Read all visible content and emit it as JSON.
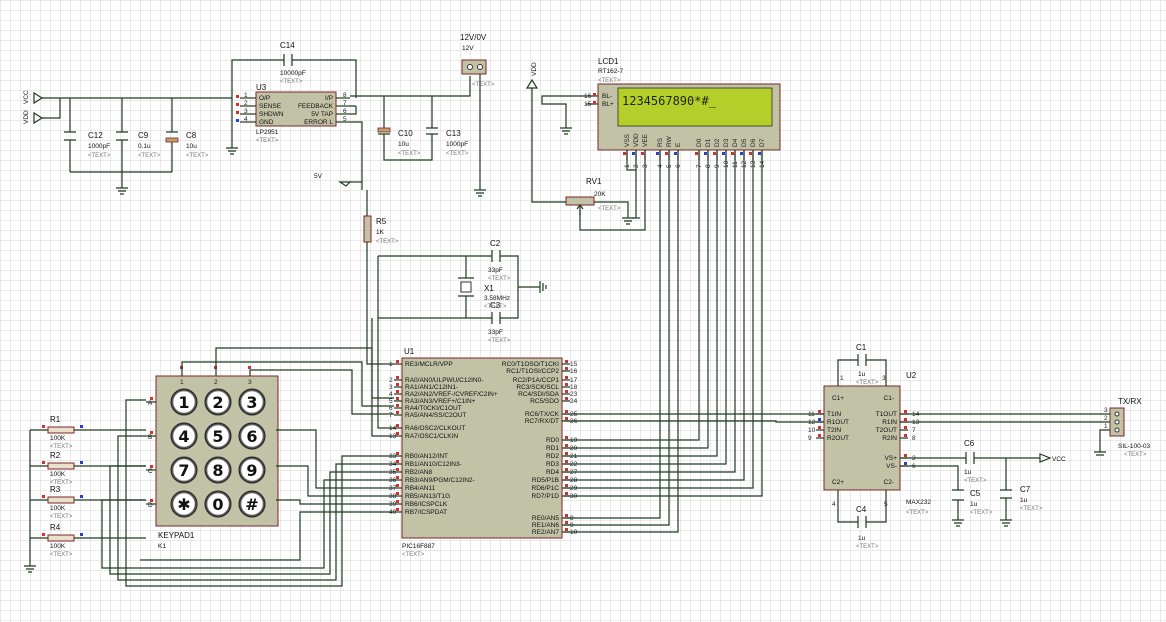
{
  "power": {
    "vcc_left_1": "VCC",
    "vcc_left_2": "VDD",
    "vdd_top": "VDD",
    "five_v": "5V",
    "vcc_right": "VCC",
    "supply_name": "12V/0V",
    "supply_value": "12V"
  },
  "placeholder": "<TEXT>",
  "regulator": {
    "ref": "U3",
    "part": "LP2951",
    "pins_left": [
      "O/P",
      "SENSE",
      "SHDWN",
      "GND"
    ],
    "pins_right": [
      "I/P",
      "FEEDBACK",
      "5V TAP",
      "ERROR L"
    ],
    "pin_numbers_left": [
      "1",
      "2",
      "3",
      "4"
    ],
    "pin_numbers_right": [
      "8",
      "7",
      "6",
      "5"
    ]
  },
  "capacitors": {
    "c14": {
      "ref": "C14",
      "value": "10000pF"
    },
    "c12": {
      "ref": "C12",
      "value": "1000pF"
    },
    "c9": {
      "ref": "C9",
      "value": "0.1u"
    },
    "c8": {
      "ref": "C8",
      "value": "10u"
    },
    "c10": {
      "ref": "C10",
      "value": "10u"
    },
    "c13": {
      "ref": "C13",
      "value": "1000pF"
    },
    "c2": {
      "ref": "C2",
      "value": "33pF"
    },
    "c3": {
      "ref": "C3",
      "value": "33pF"
    },
    "c1": {
      "ref": "C1",
      "value": "1u"
    },
    "c4": {
      "ref": "C4",
      "value": "1u"
    },
    "c5": {
      "ref": "C5",
      "value": "1u"
    },
    "c6": {
      "ref": "C6",
      "value": "1u"
    },
    "c7": {
      "ref": "C7",
      "value": "1u"
    }
  },
  "crystal": {
    "ref": "X1",
    "value": "3.58MHz"
  },
  "resistors": {
    "r5": {
      "ref": "R5",
      "value": "1K"
    },
    "r1": {
      "ref": "R1",
      "value": "100K"
    },
    "r2": {
      "ref": "R2",
      "value": "100K"
    },
    "r3": {
      "ref": "R3",
      "value": "100K"
    },
    "r4": {
      "ref": "R4",
      "value": "100K"
    }
  },
  "pot": {
    "ref": "RV1",
    "value": "20K"
  },
  "lcd": {
    "ref": "LCD1",
    "part": "RT162-7",
    "display_text": "1234567890*#_",
    "pins": [
      "VSS",
      "VDD",
      "VEE",
      "RS",
      "RW",
      "E",
      "D0",
      "D1",
      "D2",
      "D3",
      "D4",
      "D5",
      "D6",
      "D7"
    ],
    "bl_labels": [
      "BL-",
      "BL+"
    ],
    "bl_numbers": [
      "16",
      "15"
    ],
    "pin_numbers": [
      "1",
      "2",
      "3",
      "4",
      "5",
      "6",
      "7",
      "8",
      "9",
      "10",
      "11",
      "12",
      "13",
      "14"
    ],
    "colors": {
      "screen": "#b5cf2a",
      "text": "#1e2608",
      "body": "#c2c2a6"
    }
  },
  "mcu": {
    "ref": "U1",
    "part": "PIC16F887",
    "left_pins": [
      {
        "n": "1",
        "label": "RE3/MCLR/VPP"
      },
      {
        "n": "2",
        "label": "RA0/AN0/ULPWU/C12IN0-"
      },
      {
        "n": "3",
        "label": "RA1/AN1/C12IN1-"
      },
      {
        "n": "4",
        "label": "RA2/AN2/VREF-/CVREF/C2IN+"
      },
      {
        "n": "5",
        "label": "RA3/AN3/VREF+/C1IN+"
      },
      {
        "n": "6",
        "label": "RA4/T0CKI/C1OUT"
      },
      {
        "n": "7",
        "label": "RA5/AN4/SS/C2OUT"
      },
      {
        "n": "14",
        "label": "RA6/OSC2/CLKOUT"
      },
      {
        "n": "13",
        "label": "RA7/OSC1/CLKIN"
      },
      {
        "n": "33",
        "label": "RB0/AN12/INT"
      },
      {
        "n": "34",
        "label": "RB1/AN10/C12IN3-"
      },
      {
        "n": "35",
        "label": "RB2/AN8"
      },
      {
        "n": "36",
        "label": "RB3/AN9/PGM/C12IN2-"
      },
      {
        "n": "37",
        "label": "RB4/AN11"
      },
      {
        "n": "38",
        "label": "RB5/AN13/T1G"
      },
      {
        "n": "39",
        "label": "RB6/ICSPCLK"
      },
      {
        "n": "40",
        "label": "RB7/ICSPDAT"
      }
    ],
    "right_pins": [
      {
        "n": "15",
        "label": "RC0/T1OSO/T1CKI"
      },
      {
        "n": "16",
        "label": "RC1/T1OSI/CCP2"
      },
      {
        "n": "17",
        "label": "RC2/P1A/CCP1"
      },
      {
        "n": "18",
        "label": "RC3/SCK/SCL"
      },
      {
        "n": "23",
        "label": "RC4/SDI/SDA"
      },
      {
        "n": "24",
        "label": "RC5/SDO"
      },
      {
        "n": "25",
        "label": "RC6/TX/CK"
      },
      {
        "n": "26",
        "label": "RC7/RX/DT"
      },
      {
        "n": "19",
        "label": "RD0"
      },
      {
        "n": "20",
        "label": "RD1"
      },
      {
        "n": "21",
        "label": "RD2"
      },
      {
        "n": "22",
        "label": "RD3"
      },
      {
        "n": "27",
        "label": "RD4"
      },
      {
        "n": "28",
        "label": "RD5/P1B"
      },
      {
        "n": "29",
        "label": "RD6/P1C"
      },
      {
        "n": "30",
        "label": "RD7/P1D"
      },
      {
        "n": "8",
        "label": "RE0/AN5"
      },
      {
        "n": "9",
        "label": "RE1/AN6"
      },
      {
        "n": "10",
        "label": "RE2/AN7"
      }
    ]
  },
  "max232": {
    "ref": "U2",
    "part": "MAX232",
    "left_pins": [
      {
        "n": "1",
        "label": "C1+"
      },
      {
        "n": "11",
        "label": "T1IN"
      },
      {
        "n": "12",
        "label": "R1OUT"
      },
      {
        "n": "10",
        "label": "T2IN"
      },
      {
        "n": "9",
        "label": "R2OUT"
      },
      {
        "n": "4",
        "label": "C2+"
      }
    ],
    "right_pins": [
      {
        "n": "3",
        "label": "C1-"
      },
      {
        "n": "14",
        "label": "T1OUT"
      },
      {
        "n": "13",
        "label": "R1IN"
      },
      {
        "n": "7",
        "label": "T2OUT"
      },
      {
        "n": "8",
        "label": "R2IN"
      },
      {
        "n": "2",
        "label": "VS+"
      },
      {
        "n": "6",
        "label": "VS-"
      },
      {
        "n": "5",
        "label": "C2-"
      }
    ]
  },
  "keypad": {
    "ref": "KEYPAD1",
    "value": "K1",
    "keys": [
      "1",
      "2",
      "3",
      "4",
      "5",
      "6",
      "7",
      "8",
      "9",
      "✱",
      "0",
      "#"
    ],
    "rows": [
      "A",
      "B",
      "C",
      "D"
    ],
    "cols": [
      "1",
      "2",
      "3"
    ]
  },
  "connector": {
    "ref": "TX/RX",
    "part": "SIL-100-03",
    "pins": [
      "3",
      "2",
      "1"
    ]
  },
  "colors": {
    "grid_line": "#d6d6d6",
    "wire": "#1f3a1f",
    "component_fill": "#c2c2a6",
    "component_border": "#7a2626",
    "pin_marker_red": "#d03030",
    "pin_marker_blue": "#2a3fc8"
  }
}
